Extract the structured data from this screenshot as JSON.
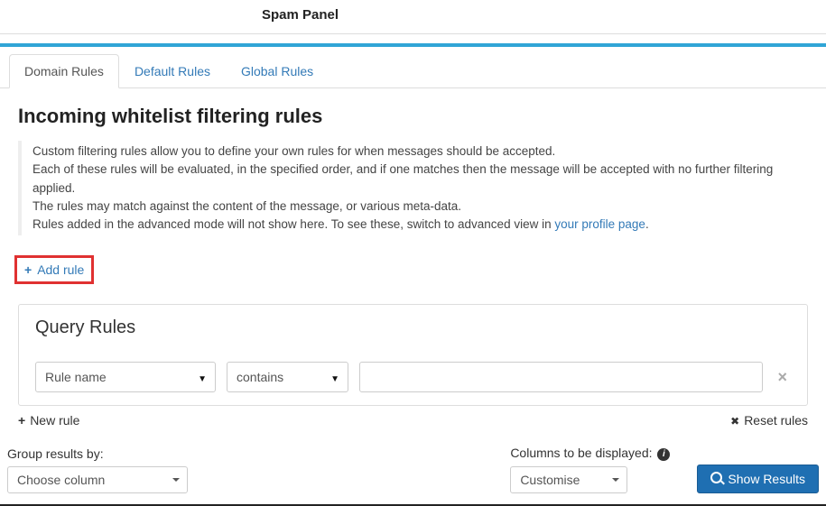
{
  "header": {
    "title": "Spam Panel"
  },
  "tabs": [
    {
      "label": "Domain Rules",
      "active": true
    },
    {
      "label": "Default Rules",
      "active": false
    },
    {
      "label": "Global Rules",
      "active": false
    }
  ],
  "section": {
    "heading": "Incoming whitelist filtering rules",
    "description_lines": [
      "Custom filtering rules allow you to define your own rules for when messages should be accepted.",
      "Each of these rules will be evaluated, in the specified order, and if one matches then the message will be accepted with no further filtering applied.",
      "The rules may match against the content of the message, or various meta-data.",
      "Rules added in the advanced mode will not show here. To see these, switch to advanced view in "
    ],
    "profile_link_text": "your profile page",
    "add_rule_label": "Add rule"
  },
  "query_panel": {
    "title": "Query Rules",
    "field_select": "Rule name",
    "operator_select": "contains",
    "value_input": "",
    "new_rule_label": "New rule",
    "reset_rules_label": "Reset rules"
  },
  "bottom": {
    "group_label": "Group results by:",
    "group_select": "Choose column",
    "columns_label": "Columns to be displayed:",
    "columns_select": "Customise",
    "show_results_label": "Show Results"
  }
}
